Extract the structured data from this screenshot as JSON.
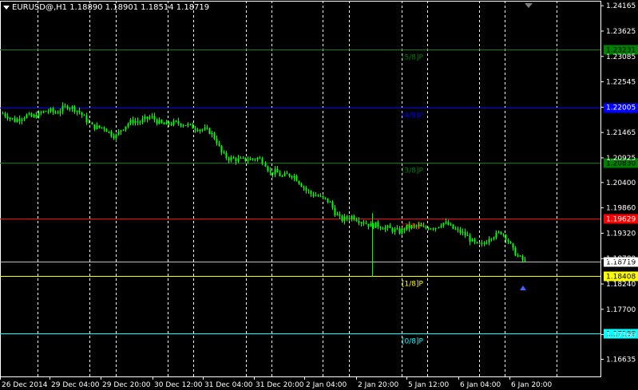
{
  "header": {
    "symbol_line": "EURUSD@,H1  1.18890 1.18901 1.18514 1.18719"
  },
  "colors": {
    "background": "#000000",
    "candle": "#00ff00",
    "grid": "#ffffff",
    "axis_text": "#ffffff"
  },
  "chart_data": {
    "type": "candlestick",
    "ylim": [
      1.1627,
      1.2427
    ],
    "y_ticks": [
      "1.24165",
      "1.23625",
      "1.23085",
      "1.22545",
      "1.22005",
      "1.21465",
      "1.20925",
      "1.20400",
      "1.19860",
      "1.19320",
      "1.18780",
      "1.18240",
      "1.17700",
      "1.17160",
      "1.16635"
    ],
    "x_ticks": [
      "26 Dec 2014",
      "29 Dec 04:00",
      "29 Dec 20:00",
      "30 Dec 12:00",
      "31 Dec 04:00",
      "31 Dec 20:00",
      "2 Jan 04:00",
      "2 Jan 20:00",
      "5 Jan 12:00",
      "6 Jan 04:00",
      "6 Jan 20:00"
    ],
    "current_price": "1.18719",
    "murrey_levels": [
      {
        "label": "[5/8]P",
        "price": 1.23231,
        "price_label": "1.23231",
        "color": "#008000",
        "label_color": "#008000",
        "text_color": "#000000"
      },
      {
        "label": "[4/8]P",
        "price": 1.22,
        "price_label": "1.22000",
        "color": "#0000ff",
        "label_color": "#0000ff",
        "text_color": "#0000ff"
      },
      {
        "label": "[3/8]P",
        "price": 1.2083,
        "price_label": "1.20830",
        "color": "#008000",
        "label_color": "#008000",
        "text_color": "#000000"
      },
      {
        "label": "[2/8]P",
        "price": 1.19629,
        "price_label": "1.19629",
        "color": "#ff0000",
        "label_color": "#ff0000",
        "text_color": "#ffffff"
      },
      {
        "label": "[1/8]P",
        "price": 1.18408,
        "price_label": "1.18408",
        "color": "#ffff00",
        "label_color": "#ffff00",
        "text_color": "#000000"
      },
      {
        "label": "[0/8]P",
        "price": 1.17188,
        "price_label": "1.17188",
        "color": "#00ffff",
        "label_color": "#00ffff",
        "text_color": "#000000"
      }
    ],
    "close_path": [
      1.2187,
      1.218,
      1.2172,
      1.2178,
      1.2183,
      1.2179,
      1.2185,
      1.2191,
      1.2193,
      1.2188,
      1.2197,
      1.2203,
      1.2198,
      1.219,
      1.2175,
      1.216,
      1.2157,
      1.2158,
      1.2145,
      1.2138,
      1.2155,
      1.2165,
      1.2172,
      1.2168,
      1.2175,
      1.218,
      1.217,
      1.2163,
      1.2165,
      1.2167,
      1.2166,
      1.2163,
      1.2158,
      1.2155,
      1.2152,
      1.2148,
      1.213,
      1.21,
      1.2092,
      1.209,
      1.2088,
      1.2089,
      1.209,
      1.2092,
      1.2085,
      1.206,
      1.2063,
      1.2052,
      1.2057,
      1.2055,
      1.204,
      1.2025,
      1.2015,
      1.2012,
      1.2005,
      1.2,
      1.1975,
      1.196,
      1.1965,
      1.1968,
      1.196,
      1.1955,
      1.1948,
      1.195,
      1.1945,
      1.1942,
      1.1938,
      1.1935,
      1.1945,
      1.1945,
      1.1948,
      1.1942,
      1.1945,
      1.1945,
      1.1955,
      1.195,
      1.194,
      1.1935,
      1.1928,
      1.1915,
      1.1905,
      1.1908,
      1.1925,
      1.1928,
      1.1935,
      1.192,
      1.1895,
      1.188,
      1.1872
    ]
  }
}
